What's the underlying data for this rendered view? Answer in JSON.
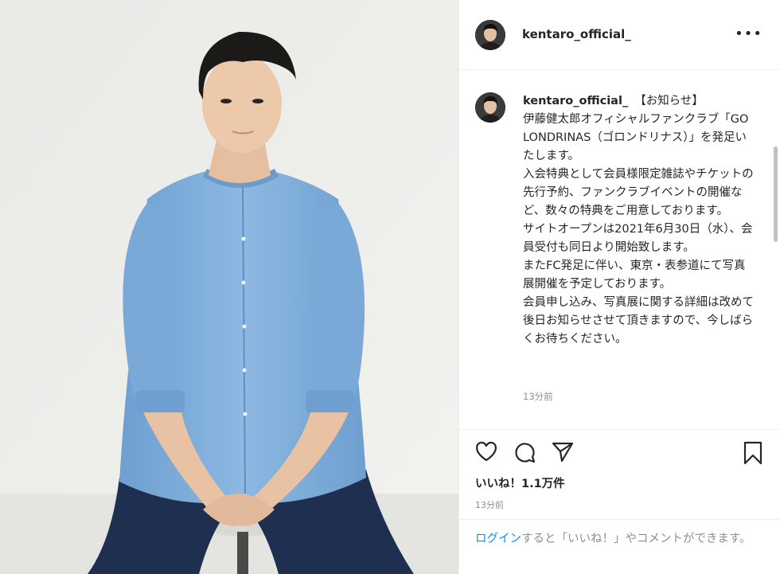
{
  "post": {
    "username": "kentaro_official_",
    "caption_username": "kentaro_official_",
    "caption": "【お知らせ】\n伊藤健太郎オフィシャルファンクラブ「GOLONDRINAS（ゴロンドリナス）」を発足いたします。\n入会特典として会員様限定雑誌やチケットの先行予約、ファンクラブイベントの開催など、数々の特典をご用意しております。\nサイトオープンは2021年6月30日（水）、会員受付も同日より開始致します。\nまたFC発足に伴い、東京・表参道にて写真展開催を予定しております。\n会員申し込み、写真展に関する詳細は改めて後日お知らせさせて頂きますので、今しばらくお待ちください。",
    "caption_time": "13分前",
    "likes": "いいね！1.1万件",
    "post_time": "13分前",
    "login_link": "ログイン",
    "login_rest": "すると「いいね！」やコメントができます。",
    "more_label": "•••"
  },
  "icons": {
    "like": "heart-icon",
    "comment": "comment-icon",
    "share": "share-icon",
    "save": "bookmark-icon",
    "more": "more-options-icon"
  }
}
